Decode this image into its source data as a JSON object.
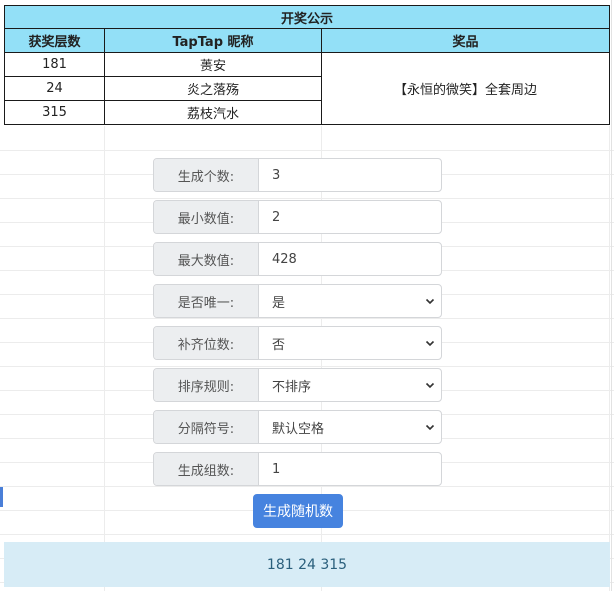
{
  "table": {
    "title": "开奖公示",
    "headers": [
      "获奖层数",
      "TapTap 昵称",
      "奖品"
    ],
    "rows": [
      {
        "floor": "181",
        "nickname": "蒉安"
      },
      {
        "floor": "24",
        "nickname": "炎之落殇"
      },
      {
        "floor": "315",
        "nickname": "荔枝汽水"
      }
    ],
    "prize": "【永恒的微笑】全套周边"
  },
  "form": {
    "count": {
      "label": "生成个数:",
      "value": "3"
    },
    "min": {
      "label": "最小数值:",
      "value": "2"
    },
    "max": {
      "label": "最大数值:",
      "value": "428"
    },
    "unique": {
      "label": "是否唯一:",
      "value": "是"
    },
    "pad": {
      "label": "补齐位数:",
      "value": "否"
    },
    "sort": {
      "label": "排序规则:",
      "value": "不排序"
    },
    "separator": {
      "label": "分隔符号:",
      "value": "默认空格"
    },
    "groups": {
      "label": "生成组数:",
      "value": "1"
    }
  },
  "button": {
    "label": "生成随机数"
  },
  "result": {
    "text": "181 24 315"
  },
  "colors": {
    "header_bg": "#93e0f7",
    "button_bg": "#4683df",
    "result_bg": "#d7ecf6"
  },
  "icons": {
    "select_caret": "chevron-down-icon"
  }
}
